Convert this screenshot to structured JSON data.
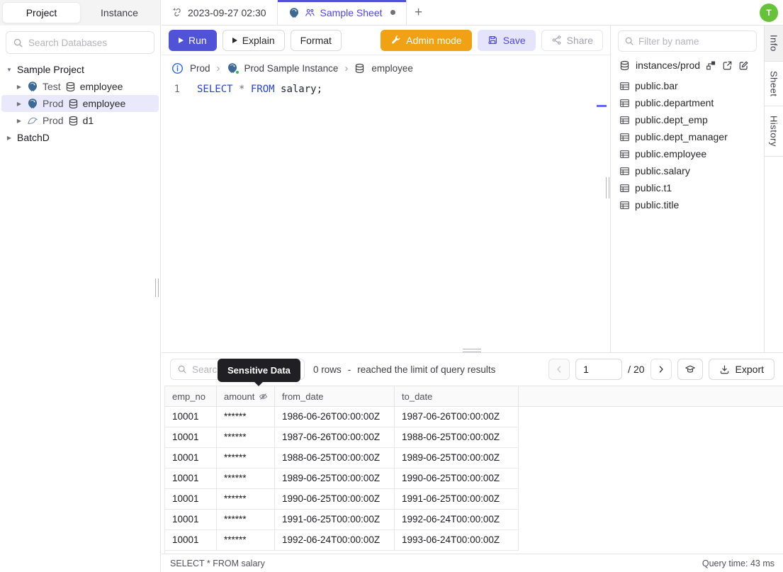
{
  "sidebar": {
    "tabs": [
      {
        "label": "Project",
        "active": true
      },
      {
        "label": "Instance",
        "active": false
      }
    ],
    "search_placeholder": "Search Databases",
    "project_root": "Sample Project",
    "databases": [
      {
        "env": "Test",
        "name": "employee",
        "engine": "postgres",
        "selected": false
      },
      {
        "env": "Prod",
        "name": "employee",
        "engine": "postgres",
        "selected": true
      },
      {
        "env": "Prod",
        "name": "d1",
        "engine": "mysql",
        "selected": false
      }
    ],
    "collapsed_project": "BatchD"
  },
  "tab_bar": {
    "history_tab": "2023-09-27 02:30",
    "sheet_tab": "Sample Sheet",
    "new_tab": "+",
    "avatar_initial": "T"
  },
  "toolbar": {
    "run": "Run",
    "explain": "Explain",
    "format": "Format",
    "admin_mode": "Admin mode",
    "save": "Save",
    "share": "Share"
  },
  "breadcrumb": {
    "environment": "Prod",
    "instance": "Prod Sample Instance",
    "database": "employee"
  },
  "editor": {
    "line_number": "1",
    "sql": {
      "kw1": "SELECT",
      "op": " * ",
      "kw2": "FROM",
      "rest": " salary;"
    }
  },
  "right_panel": {
    "filter_placeholder": "Filter by name",
    "connection": "instances/prod",
    "tables": [
      "public.bar",
      "public.department",
      "public.dept_emp",
      "public.dept_manager",
      "public.employee",
      "public.salary",
      "public.t1",
      "public.title"
    ]
  },
  "right_rail": {
    "tabs": [
      {
        "label": "Info",
        "active": true
      },
      {
        "label": "Sheet",
        "active": false
      },
      {
        "label": "History",
        "active": false
      }
    ]
  },
  "results": {
    "search_placeholder": "Search",
    "tooltip": "Sensitive Data",
    "row_summary": "0 rows",
    "summary_separator": "-",
    "limit_note": "reached the limit of query results",
    "page_value": "1",
    "page_total": "/ 20",
    "export": "Export",
    "columns": [
      "emp_no",
      "amount",
      "from_date",
      "to_date"
    ],
    "masked_column": "amount",
    "rows": [
      [
        "10001",
        "******",
        "1986-06-26T00:00:00Z",
        "1987-06-26T00:00:00Z"
      ],
      [
        "10001",
        "******",
        "1987-06-26T00:00:00Z",
        "1988-06-25T00:00:00Z"
      ],
      [
        "10001",
        "******",
        "1988-06-25T00:00:00Z",
        "1989-06-25T00:00:00Z"
      ],
      [
        "10001",
        "******",
        "1989-06-25T00:00:00Z",
        "1990-06-25T00:00:00Z"
      ],
      [
        "10001",
        "******",
        "1990-06-25T00:00:00Z",
        "1991-06-25T00:00:00Z"
      ],
      [
        "10001",
        "******",
        "1991-06-25T00:00:00Z",
        "1992-06-24T00:00:00Z"
      ],
      [
        "10001",
        "******",
        "1992-06-24T00:00:00Z",
        "1993-06-24T00:00:00Z"
      ]
    ]
  },
  "status_bar": {
    "query": "SELECT * FROM salary",
    "query_time": "Query time: 43 ms"
  },
  "colors": {
    "accent": "#5151d9",
    "admin_orange": "#f0a114",
    "save_bg": "#e4e4fb",
    "avatar_green": "#66c238",
    "instance_status_green": "#2fbf4f",
    "selected_row_bg": "#e9e9fb",
    "tooltip_bg": "#202024"
  }
}
